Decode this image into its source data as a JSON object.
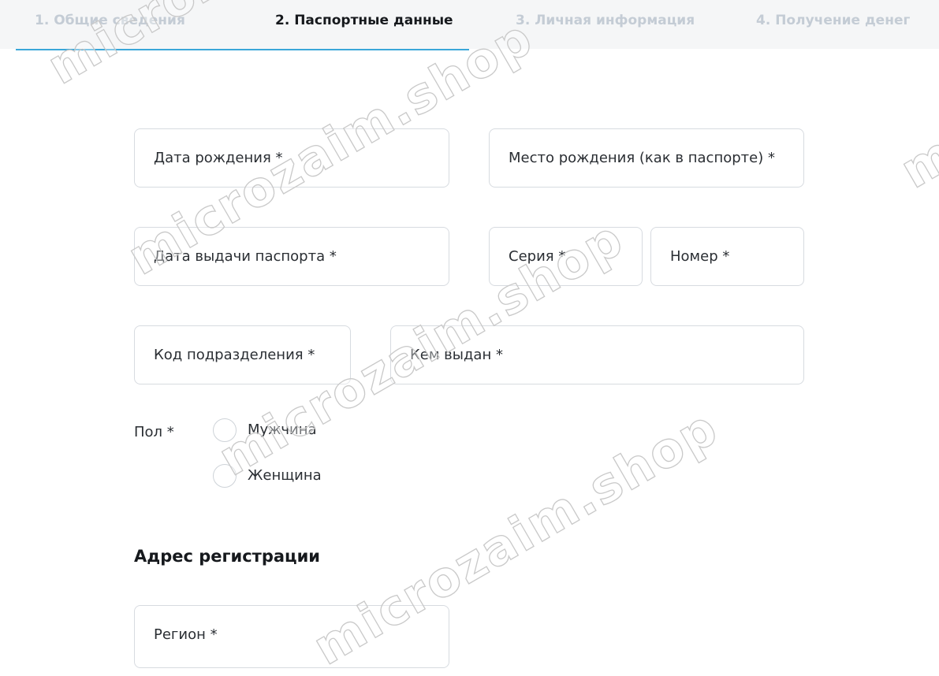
{
  "steps": [
    {
      "label": "1. Общие сведения",
      "active": false
    },
    {
      "label": "2. Паспортные данные",
      "active": true
    },
    {
      "label": "3. Личная информация",
      "active": false
    },
    {
      "label": "4. Получение денег",
      "active": false
    }
  ],
  "form": {
    "birth_date": "Дата рождения *",
    "birth_place": "Место рождения (как в паспорте) *",
    "issue_date": "Дата выдачи паспорта *",
    "series": "Серия *",
    "number": "Номер *",
    "division_code": "Код подразделения *",
    "issued_by": "Кем выдан *",
    "gender_label": "Пол *",
    "gender_male": "Мужчина",
    "gender_female": "Женщина",
    "address_title": "Адрес регистрации",
    "region": "Регион *"
  },
  "watermark": "microzaim.shop",
  "colors": {
    "accent": "#3aa7d9",
    "inactive_step": "#c4ccd5",
    "border": "#d7dbe0"
  }
}
